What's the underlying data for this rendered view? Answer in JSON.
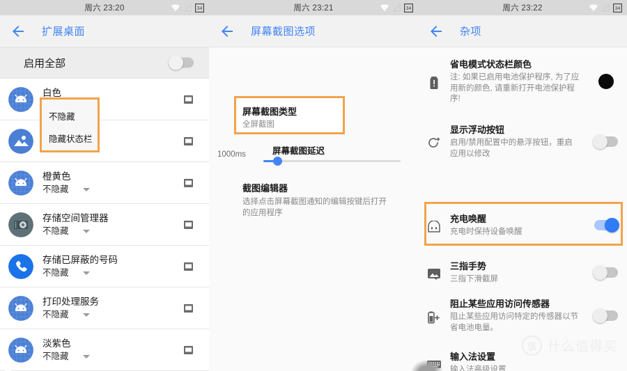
{
  "statusbar": {
    "left_time": "周六 23:20",
    "mid_time": "周六 23:21",
    "right_time": "周六 23:22",
    "battery_level": "34",
    "icons": [
      "wifi-icon",
      "signal-off-icon",
      "battery-icon"
    ]
  },
  "left_screen": {
    "title": "扩展桌面",
    "back_label": "返回",
    "enable_all": {
      "label": "启用全部",
      "toggle_state": "off"
    },
    "dropdown": {
      "visible": true,
      "highlight_color": "#f2a34a",
      "options": [
        "不隐藏",
        "隐藏状态栏"
      ]
    },
    "apps": [
      {
        "name": "白色",
        "value": "不隐藏",
        "icon": "android-robot-icon"
      },
      {
        "name": "",
        "value": "",
        "icon": "gallery-image-icon"
      },
      {
        "name": "橙黄色",
        "value": "不隐藏",
        "icon": "android-robot-icon"
      },
      {
        "name": "存储空间管理器",
        "value": "不隐藏",
        "icon": "storage-manager-icon"
      },
      {
        "name": "存储已屏蔽的号码",
        "value": "不隐藏",
        "icon": "phone-icon"
      },
      {
        "name": "打印处理服务",
        "value": "不隐藏",
        "icon": "android-robot-icon"
      },
      {
        "name": "淡紫色",
        "value": "不隐藏",
        "icon": "android-robot-icon"
      }
    ]
  },
  "mid_screen": {
    "title": "屏幕截图选项",
    "highlight_color": "#f2a34a",
    "shot_type": {
      "title": "屏幕截图类型",
      "value": "全屏截图",
      "highlighted": true
    },
    "delay": {
      "title": "屏幕截图延迟",
      "value_label": "1000ms",
      "slider_percent": 10
    },
    "editor": {
      "title": "截图编辑器",
      "desc": "选择点击屏幕截图通知的编辑按键后打开的应用程序"
    }
  },
  "right_screen": {
    "title": "杂项",
    "highlight_color": "#f2a34a",
    "rows": [
      {
        "title": "省电模式状态栏颜色",
        "sub": "注: 如果已启用电池保护程序, 为了应用新的颜色, 请重新打开电池保护程序!",
        "icon": "battery-alert-icon",
        "control": "color-swatch",
        "swatch_color": "#0a0a0a"
      },
      {
        "title": "显示浮动按钮",
        "sub": "启用/禁用配置中的悬浮按钮，重启应用以修改",
        "icon": "refresh-plus-icon",
        "control": "toggle",
        "toggle_state": "off"
      },
      {
        "title": "充电唤醒",
        "sub": "充电时保持设备唤醒",
        "icon": "power-outlet-icon",
        "control": "toggle",
        "toggle_state": "on",
        "highlighted": true
      },
      {
        "title": "三指手势",
        "sub": "三指下滑截屏",
        "icon": "image-gesture-icon",
        "control": "toggle",
        "toggle_state": "off"
      },
      {
        "title": "阻止某些应用访问传感器",
        "sub": "阻止某些应用访问特定的传感器以节省电池电量。",
        "icon": "battery-plus-icon",
        "control": "toggle",
        "toggle_state": "off"
      },
      {
        "title": "输入法设置",
        "sub": "输入法高级设置",
        "icon": "keyboard-icon",
        "control": "none"
      }
    ]
  },
  "watermark": {
    "badge": "值",
    "text": "什么值得买"
  }
}
